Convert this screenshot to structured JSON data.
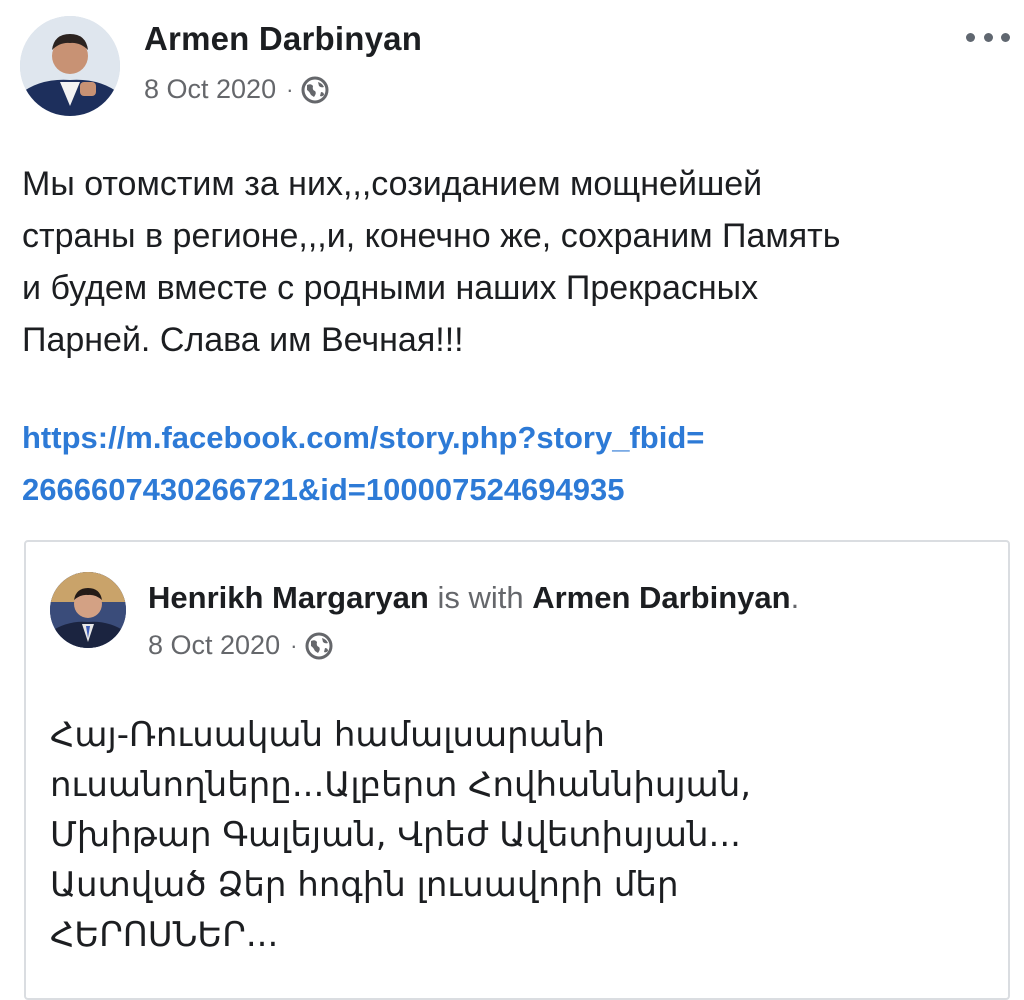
{
  "post": {
    "author": "Armen Darbinyan",
    "date": "8 Oct 2020",
    "separator": "·",
    "text_lines": [
      "Мы отомстим за них,,,созиданием мощнейшей",
      "страны в регионе,,,и, конечно же, сохраним Память",
      "и будем вместе с родными наших Прекрасных",
      "Парней. Слава им Вечная!!!"
    ],
    "link_lines": [
      "https://m.facebook.com/story.php?story_fbid=",
      "2666607430266721&id=100007524694935"
    ]
  },
  "shared_post": {
    "author": "Henrikh Margaryan",
    "with_text": " is with ",
    "tagged": "Armen Darbinyan",
    "period": ".",
    "date": "8 Oct 2020",
    "separator": "·",
    "text_lines": [
      "Հայ-Ռուսական համալսարանի",
      "ուսանողները...Ալբերտ Հովհաննիսյան,",
      "Մխիթար Գալեյան, Վրեժ Ավետիսյան...",
      "Աստված Ձեր հոգին լուսավորի մեր",
      "ՀԵՐՈՍՆԵՐ..."
    ]
  },
  "icons": {
    "privacy": "globe-icon",
    "menu": "more-options-icon"
  },
  "colors": {
    "link": "#2d7ad6",
    "muted": "#65676b",
    "text": "#1c1e21"
  }
}
